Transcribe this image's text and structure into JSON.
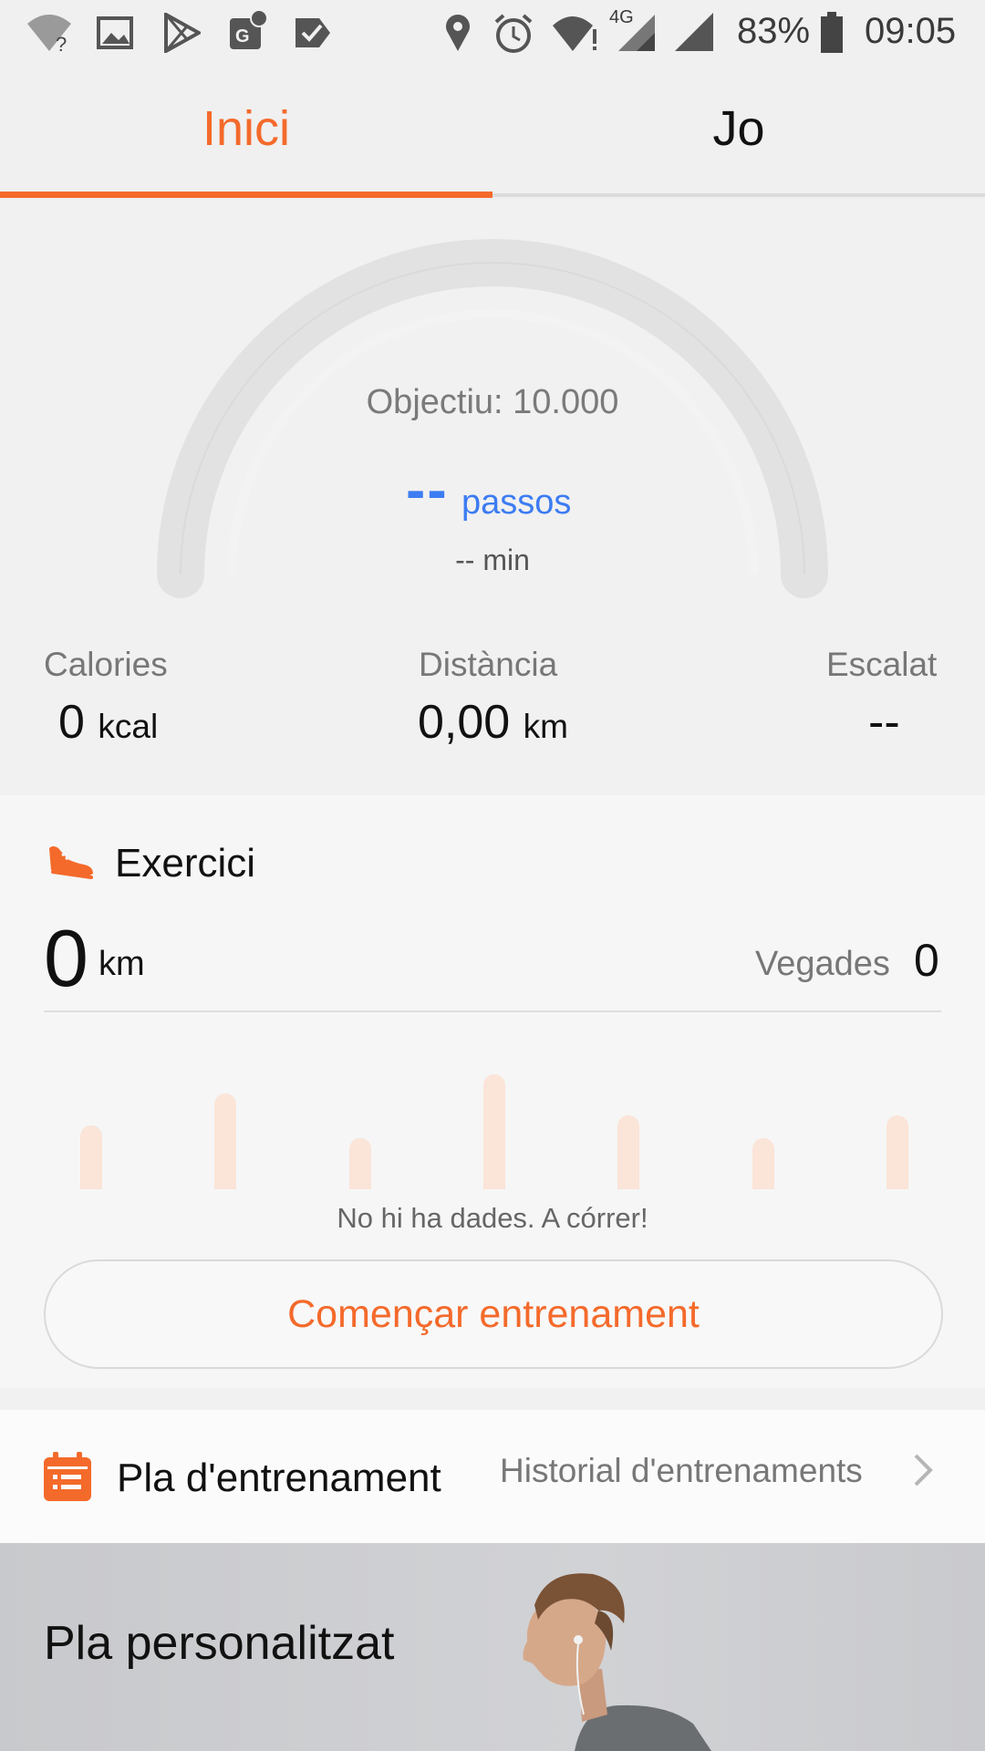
{
  "status_bar": {
    "battery": "83%",
    "time": "09:05",
    "network": "4G",
    "icons": [
      "wifi-unknown-icon",
      "image-icon",
      "play-store-icon",
      "maps-icon",
      "tasks-icon",
      "location-icon",
      "alarm-icon",
      "wifi-icon",
      "signal-4g-icon",
      "signal-icon",
      "battery-icon"
    ]
  },
  "tabs": [
    {
      "label": "Inici",
      "active": true
    },
    {
      "label": "Jo",
      "active": false
    }
  ],
  "activity": {
    "goal": "Objectiu: 10.000",
    "steps_value": "--",
    "steps_unit": "passos",
    "minutes": "-- min",
    "stats": [
      {
        "label": "Calories",
        "value": "0",
        "unit": "kcal"
      },
      {
        "label": "Distància",
        "value": "0,00",
        "unit": "km"
      },
      {
        "label": "Escalat",
        "value": "--",
        "unit": ""
      }
    ]
  },
  "exercise": {
    "title": "Exercici",
    "distance_value": "0",
    "distance_unit": "km",
    "times_label": "Vegades",
    "times_value": "0",
    "placeholder_bars": [
      0.5,
      0.75,
      0.4,
      0.9,
      0.58,
      0.4,
      0.58
    ],
    "empty_message": "No hi ha dades. A córrer!",
    "start_button": "Començar entrenament"
  },
  "plan": {
    "title": "Pla d'entrenament",
    "history_link": "Historial d'entrenaments"
  },
  "banner": {
    "title": "Pla personalitzat"
  },
  "colors": {
    "accent": "#f46a2b",
    "steps": "#3d7cf2",
    "bar_placeholder": "#fbe4d8"
  }
}
